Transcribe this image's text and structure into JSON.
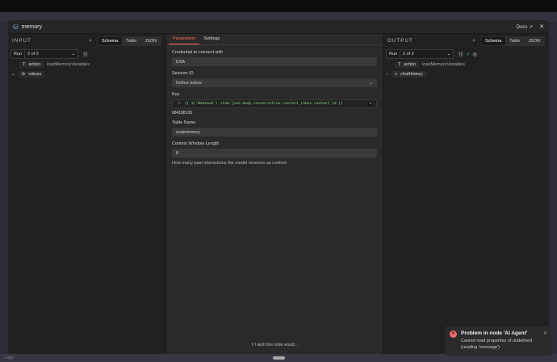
{
  "node": {
    "title": "memory",
    "docs": "Docs"
  },
  "input": {
    "label": "INPUT",
    "tabs": [
      "Schema",
      "Table",
      "JSON"
    ],
    "run_label": "Run",
    "run_value": "2 of 2",
    "fields": [
      {
        "name": "action",
        "value": "loadMemoryVariables"
      },
      {
        "name": "values",
        "value": ""
      }
    ]
  },
  "params": {
    "tabs": [
      "Parameters",
      "Settings"
    ],
    "credential_label": "Credential to connect with",
    "credential": "ESA",
    "session_label": "Session ID",
    "session": "Define below",
    "key_label": "Key",
    "key_expr": "{{ $('Webhook').item.json.body.conversation.contact_inbox.contact_id }}",
    "key_result": "684188130",
    "table_label": "Table Name",
    "table": "esaimemory",
    "context_label": "Context Window Length",
    "context": "8",
    "context_hint": "How many past interactions the model receives as context",
    "feedback": "I wish this node would..."
  },
  "output": {
    "label": "OUTPUT",
    "tabs": [
      "Schema",
      "Table",
      "JSON"
    ],
    "run_label": "Run",
    "run_value": "2 of 2",
    "fields": [
      {
        "name": "action",
        "value": "loadMemoryVariables"
      },
      {
        "name": "chatHistory",
        "value": ""
      }
    ]
  },
  "toast": {
    "title": "Problem in node 'AI Agent'",
    "message": "Cannot read properties of undefined (reading 'message')"
  },
  "logs": "Logs"
}
